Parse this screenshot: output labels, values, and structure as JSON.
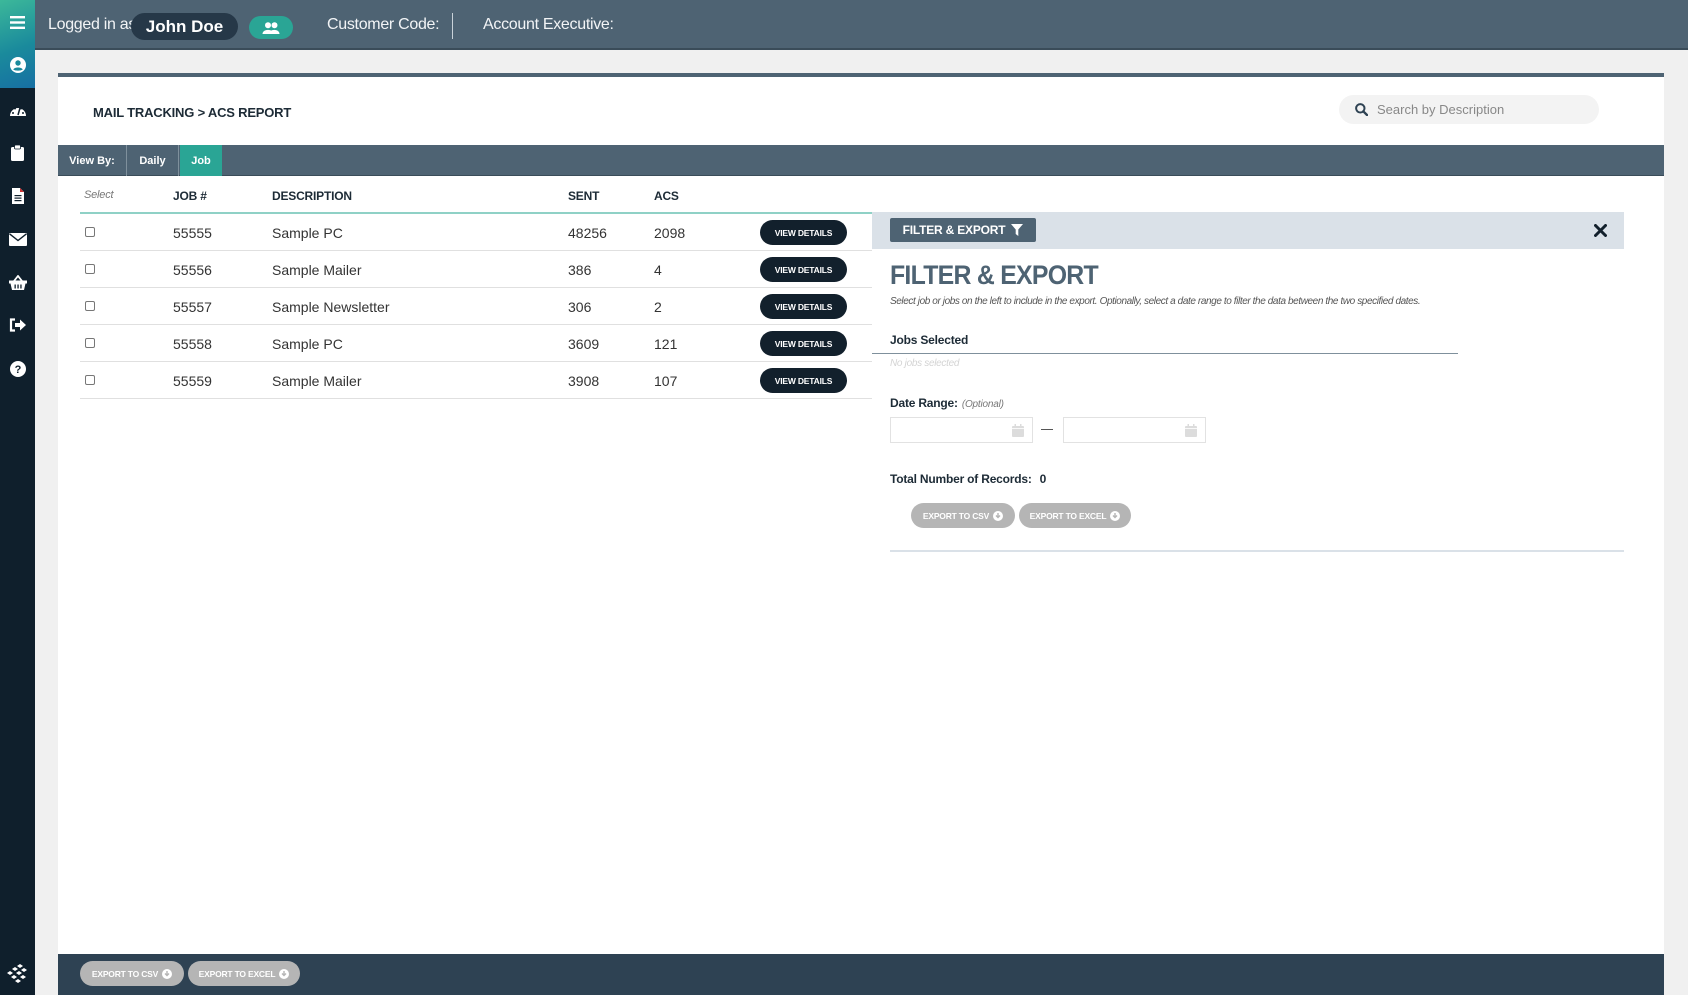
{
  "header": {
    "logged_in_label": "Logged in as:",
    "user_name": "John Doe",
    "customer_code_label": "Customer Code:",
    "account_executive_label": "Account Executive:"
  },
  "sidebar": {
    "items": [
      {
        "icon": "menu-icon"
      },
      {
        "icon": "user-circle-icon"
      },
      {
        "icon": "dashboard-gauge-icon"
      },
      {
        "icon": "clipboard-icon"
      },
      {
        "icon": "document-icon"
      },
      {
        "icon": "envelope-icon"
      },
      {
        "icon": "basket-icon"
      },
      {
        "icon": "sign-out-icon"
      },
      {
        "icon": "help-icon"
      }
    ],
    "logo_icon": "layers-logo-icon"
  },
  "page": {
    "breadcrumb": "MAIL TRACKING > ACS REPORT",
    "search_placeholder": "Search by Description",
    "view_by_label": "View By:",
    "view_tabs": [
      {
        "label": "Daily",
        "active": false
      },
      {
        "label": "Job",
        "active": true
      }
    ]
  },
  "table": {
    "columns": [
      "Select",
      "JOB #",
      "DESCRIPTION",
      "SENT",
      "ACS"
    ],
    "row_button_label": "VIEW DETAILS",
    "rows": [
      {
        "job": "55555",
        "description": "Sample PC",
        "sent": "48256",
        "acs": "2098",
        "checked": false
      },
      {
        "job": "55556",
        "description": "Sample Mailer",
        "sent": "386",
        "acs": "4",
        "checked": false
      },
      {
        "job": "55557",
        "description": "Sample Newsletter",
        "sent": "306",
        "acs": "2",
        "checked": false
      },
      {
        "job": "55558",
        "description": "Sample PC",
        "sent": "3609",
        "acs": "121",
        "checked": false
      },
      {
        "job": "55559",
        "description": "Sample Mailer",
        "sent": "3908",
        "acs": "107",
        "checked": false
      }
    ]
  },
  "filter_panel": {
    "tag_label": "FILTER & EXPORT",
    "title": "FILTER & EXPORT",
    "description": "Select job or jobs on the left to include in the export. Optionally, select a date range to filter the data between the two specified dates.",
    "jobs_selected_label": "Jobs Selected",
    "jobs_selected_empty": "No jobs selected",
    "date_range_label": "Date Range:",
    "date_range_optional": "(Optional)",
    "date_from": "",
    "date_to": "",
    "total_records_label": "Total Number of Records:",
    "total_records_value": "0",
    "export_csv_label": "EXPORT TO CSV",
    "export_excel_label": "EXPORT TO EXCEL"
  },
  "bottom_bar": {
    "export_csv_label": "EXPORT TO CSV",
    "export_excel_label": "EXPORT TO EXCEL"
  },
  "colors": {
    "header_bg": "#4e6373",
    "accent_teal": "#2aa595",
    "sidebar_bg": "#0f1f2c",
    "button_dark": "#12202c",
    "button_disabled": "#b5b5b5",
    "panel_bar": "#dae1e8"
  }
}
